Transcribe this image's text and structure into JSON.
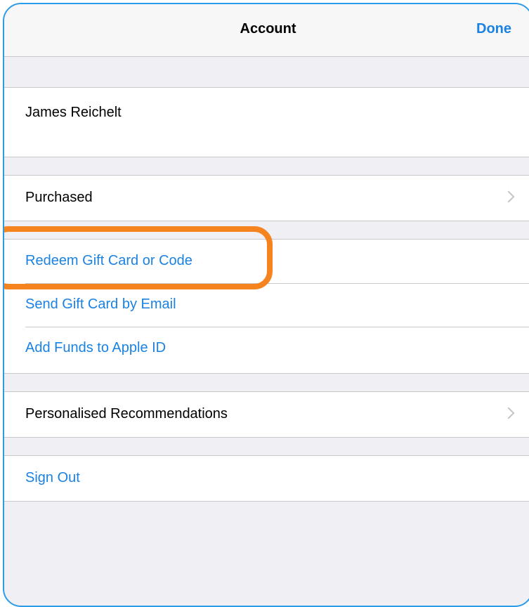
{
  "header": {
    "title": "Account",
    "done_label": "Done"
  },
  "account": {
    "user_name": "James Reichelt"
  },
  "purchases": {
    "purchased_label": "Purchased"
  },
  "gift": {
    "redeem_label": "Redeem Gift Card or Code",
    "send_label": "Send Gift Card by Email",
    "add_funds_label": "Add Funds to Apple ID"
  },
  "recommendations": {
    "label": "Personalised Recommendations"
  },
  "session": {
    "sign_out_label": "Sign Out"
  },
  "colors": {
    "accent": "#1a82e2",
    "highlight": "#f5841f",
    "sheet_border": "#2c9be8",
    "background": "#efeff4"
  }
}
